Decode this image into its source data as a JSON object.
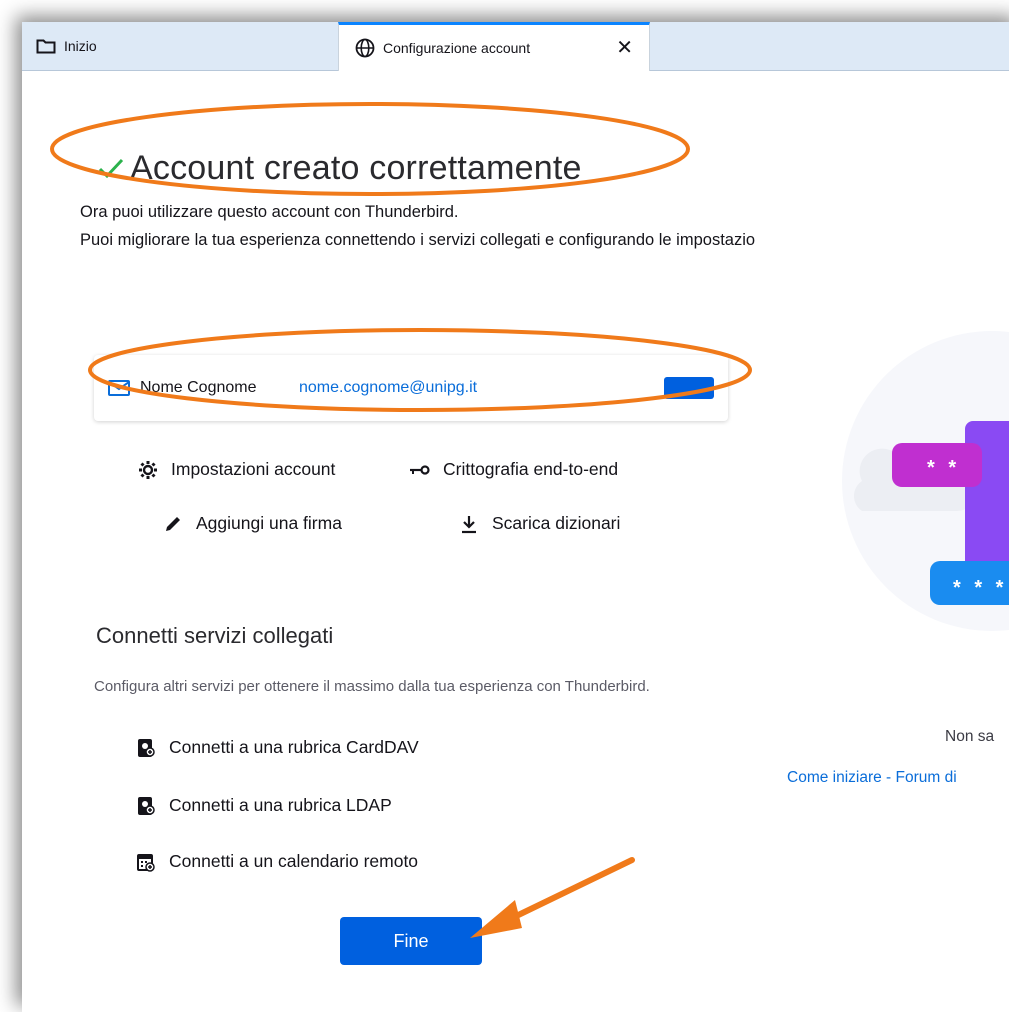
{
  "tabs": [
    {
      "label": "Inizio"
    },
    {
      "label": "Configurazione account",
      "close": "✕"
    }
  ],
  "header": {
    "title": "Account creato correttamente",
    "line1": "Ora puoi utilizzare questo account con Thunderbird.",
    "line2": "Puoi migliorare la tua esperienza connettendo i servizi collegati e configurando le impostazio"
  },
  "account": {
    "name": "Nome Cognome",
    "email": "nome.cognome@unipg.it"
  },
  "actions": {
    "settings": "Impostazioni account",
    "e2e": "Crittografia end-to-end",
    "signature": "Aggiungi una firma",
    "dictionaries": "Scarica dizionari"
  },
  "services": {
    "title": "Connetti servizi collegati",
    "description": "Configura altri servizi per ottenere il massimo dalla tua esperienza con Thunderbird.",
    "items": [
      {
        "label": "Connetti a una rubrica CardDAV"
      },
      {
        "label": "Connetti a una rubrica LDAP"
      },
      {
        "label": "Connetti a un calendario remoto"
      }
    ]
  },
  "finish_button": "Fine",
  "side": {
    "help_text": "Non sa",
    "links": "Come iniziare - Forum di",
    "password_stars_top": "* *",
    "password_stars_bottom": "* * *"
  },
  "colors": {
    "accent": "#0060df",
    "link": "#0a6dd9",
    "annotation": "#f07a1a",
    "check": "#2ac3a2"
  }
}
